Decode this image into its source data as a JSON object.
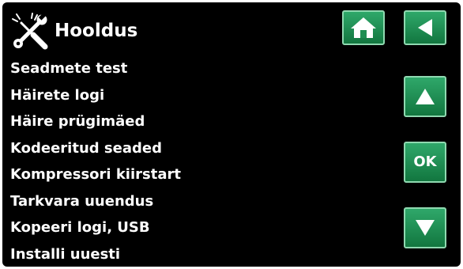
{
  "header": {
    "title": "Hooldus",
    "icon": "tools-icon"
  },
  "menu": {
    "items": [
      {
        "label": "Seadmete test"
      },
      {
        "label": "Häirete logi"
      },
      {
        "label": "Häire prügimäed"
      },
      {
        "label": "Kodeeritud seaded"
      },
      {
        "label": "Kompressori kiirstart"
      },
      {
        "label": "Tarkvara uuendus"
      },
      {
        "label": "Kopeeri logi, USB"
      },
      {
        "label": "Installi uuesti"
      }
    ]
  },
  "buttons": {
    "home_icon": "home-icon",
    "back_icon": "back-arrow-icon",
    "up_icon": "up-arrow-icon",
    "ok_label": "OK",
    "down_icon": "down-arrow-icon"
  },
  "colors": {
    "background": "#000000",
    "text": "#ffffff",
    "button": "#1e8e52"
  }
}
